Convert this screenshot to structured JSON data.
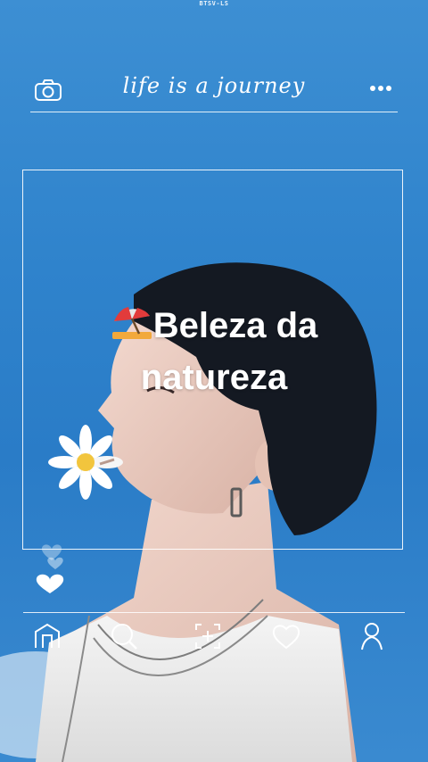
{
  "watermark": "BTSV-LS",
  "header": {
    "title": "life is a journey",
    "camera_icon": "camera-icon",
    "more_icon": "more-dots-icon"
  },
  "post": {
    "caption_line1": "Beleza da",
    "caption_line2": "natureza",
    "caption_emoji": "beach-umbrella-icon"
  },
  "nav": {
    "items": [
      "home-icon",
      "search-icon",
      "add-post-icon",
      "heart-icon",
      "profile-icon"
    ]
  },
  "colors": {
    "background": "#2f83cc",
    "foreground": "#ffffff"
  }
}
